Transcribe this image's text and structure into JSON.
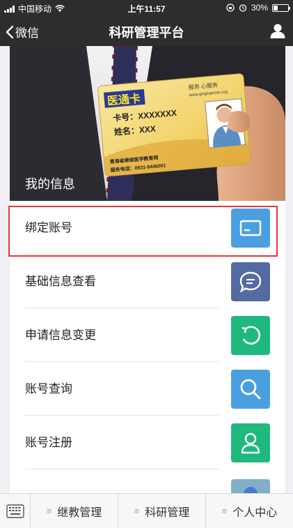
{
  "status_bar": {
    "carrier": "中国移动",
    "time": "上午11:57",
    "battery": "30%",
    "battery_level": 0.3
  },
  "nav": {
    "back_label": "微信",
    "title": "科研管理平台"
  },
  "banner": {
    "title": "我的信息",
    "card": {
      "brand": "医通卡",
      "tagline": "服务 心服务",
      "url": "www.qinghaicme.org",
      "card_no_label": "卡号：XXXXXXX",
      "name_label": "姓名：XXX",
      "org": "青海省继续医学教育网",
      "phone": "服务电话：0931-8446001"
    }
  },
  "menu": [
    {
      "label": "绑定账号",
      "icon": "card-icon",
      "color": "#4a9fe0"
    },
    {
      "label": "基础信息查看",
      "icon": "chat-bubble-icon",
      "color": "#536ba0"
    },
    {
      "label": "申请信息变更",
      "icon": "refresh-icon",
      "color": "#1fb87e"
    },
    {
      "label": "账号查询",
      "icon": "search-icon",
      "color": "#4a9fe0"
    },
    {
      "label": "账号注册",
      "icon": "user-icon",
      "color": "#1fb87e"
    }
  ],
  "tabs": [
    {
      "label": "继教管理"
    },
    {
      "label": "科研管理"
    },
    {
      "label": "个人中心"
    }
  ],
  "colors": {
    "bar_bg": "#2d2d2d",
    "highlight": "#e0393e"
  }
}
